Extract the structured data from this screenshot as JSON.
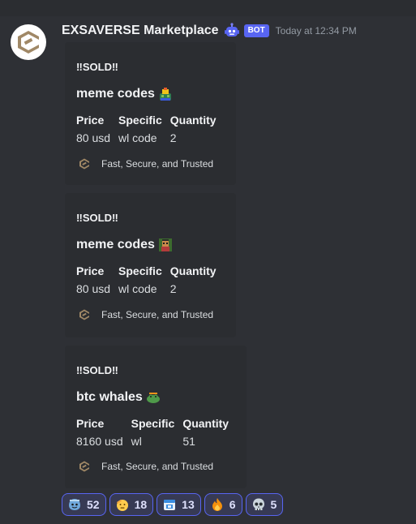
{
  "message": {
    "username": "EXSAVERSE Marketplace",
    "bot_tag": "BOT",
    "timestamp": "Today at 12:34 PM",
    "avatar_icon": "exsaverse-logo",
    "bot_icon": "robot-icon"
  },
  "colors": {
    "background": "#313338",
    "embed_background": "#2b2d31",
    "bot_tag": "#5865f2",
    "logo": "#a08866"
  },
  "embeds": [
    {
      "status": "‼SOLD‼",
      "title": "meme codes",
      "title_emoji": "frog-wizard-emoji",
      "fields": [
        {
          "name": "Price",
          "value": "80 usd"
        },
        {
          "name": "Specific",
          "value": "wl code"
        },
        {
          "name": "Quantity",
          "value": "2"
        }
      ],
      "footer": "Fast, Secure, and Trusted"
    },
    {
      "status": "‼SOLD‼",
      "title": "meme codes",
      "title_emoji": "pixel-character-emoji",
      "fields": [
        {
          "name": "Price",
          "value": "80 usd"
        },
        {
          "name": "Specific",
          "value": "wl code"
        },
        {
          "name": "Quantity",
          "value": "2"
        }
      ],
      "footer": "Fast, Secure, and Trusted"
    },
    {
      "status": "‼SOLD‼",
      "title": "btc whales",
      "title_emoji": "whale-frog-emoji",
      "fields": [
        {
          "name": "Price",
          "value": "8160 usd"
        },
        {
          "name": "Specific",
          "value": "wl"
        },
        {
          "name": "Quantity",
          "value": "51"
        }
      ],
      "footer": "Fast, Secure, and Trusted"
    }
  ],
  "reactions": [
    {
      "emoji": "sparkle-blob-emoji",
      "count": "52"
    },
    {
      "emoji": "saluting-face-emoji",
      "count": "18"
    },
    {
      "emoji": "blue-calendar-emoji",
      "count": "13"
    },
    {
      "emoji": "fire-emoji",
      "count": "6"
    },
    {
      "emoji": "skull-emoji",
      "count": "5"
    }
  ]
}
